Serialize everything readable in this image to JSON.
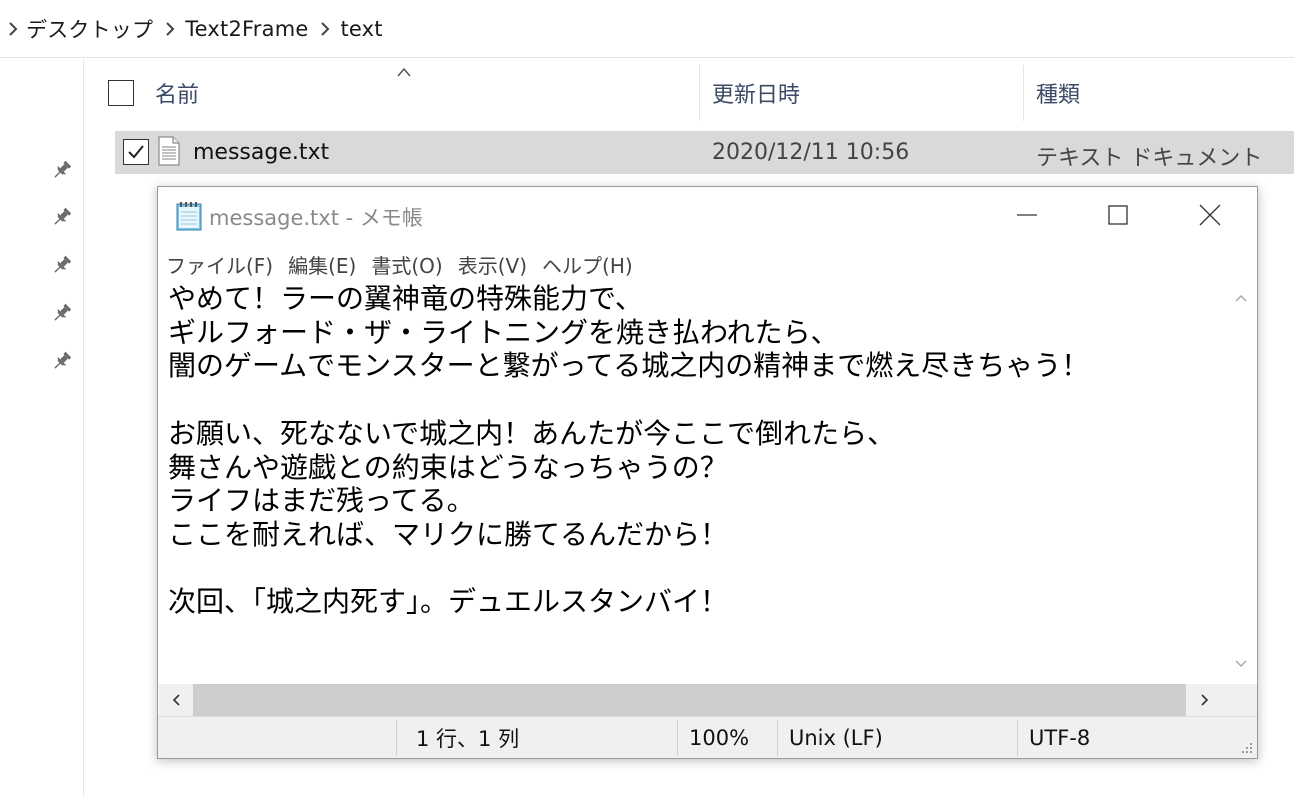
{
  "breadcrumb": [
    {
      "label": "デスクトップ"
    },
    {
      "label": "Text2Frame"
    },
    {
      "label": "text"
    }
  ],
  "columns": {
    "name": "名前",
    "date_modified": "更新日時",
    "type": "種類"
  },
  "file": {
    "name": "message.txt",
    "date": "2020/12/11 10:56",
    "type": "テキスト ドキュメント",
    "checked": true
  },
  "notepad": {
    "title": "message.txt - メモ帳",
    "menu": [
      "ファイル(F)",
      "編集(E)",
      "書式(O)",
      "表示(V)",
      "ヘルプ(H)"
    ],
    "content": "やめて！ラーの翼神竜の特殊能力で、\nギルフォード・ザ・ライトニングを焼き払われたら、\n闇のゲームでモンスターと繋がってる城之内の精神まで燃え尽きちゃう！\n\nお願い、死なないで城之内！あんたが今ここで倒れたら、\n舞さんや遊戯との約束はどうなっちゃうの？\nライフはまだ残ってる。\nここを耐えれば、マリクに勝てるんだから！\n\n次回、「城之内死す」。デュエルスタンバイ！",
    "status": {
      "position": "1 行、1 列",
      "zoom": "100%",
      "line_ending": "Unix (LF)",
      "encoding": "UTF-8"
    }
  },
  "icons": {
    "breadcrumb_separator": "chevron-right-icon",
    "pin": "pin-icon",
    "sort": "sort-ascending-icon",
    "file": "text-file-icon",
    "app": "notepad-icon",
    "minimize": "minimize-icon",
    "maximize": "maximize-icon",
    "close": "close-icon"
  },
  "colors": {
    "selection_row": "#d9d9d9",
    "header_text": "#3b4a66",
    "scroll_thumb": "#cdcdcd",
    "statusbar_bg": "#f0f0f0"
  }
}
